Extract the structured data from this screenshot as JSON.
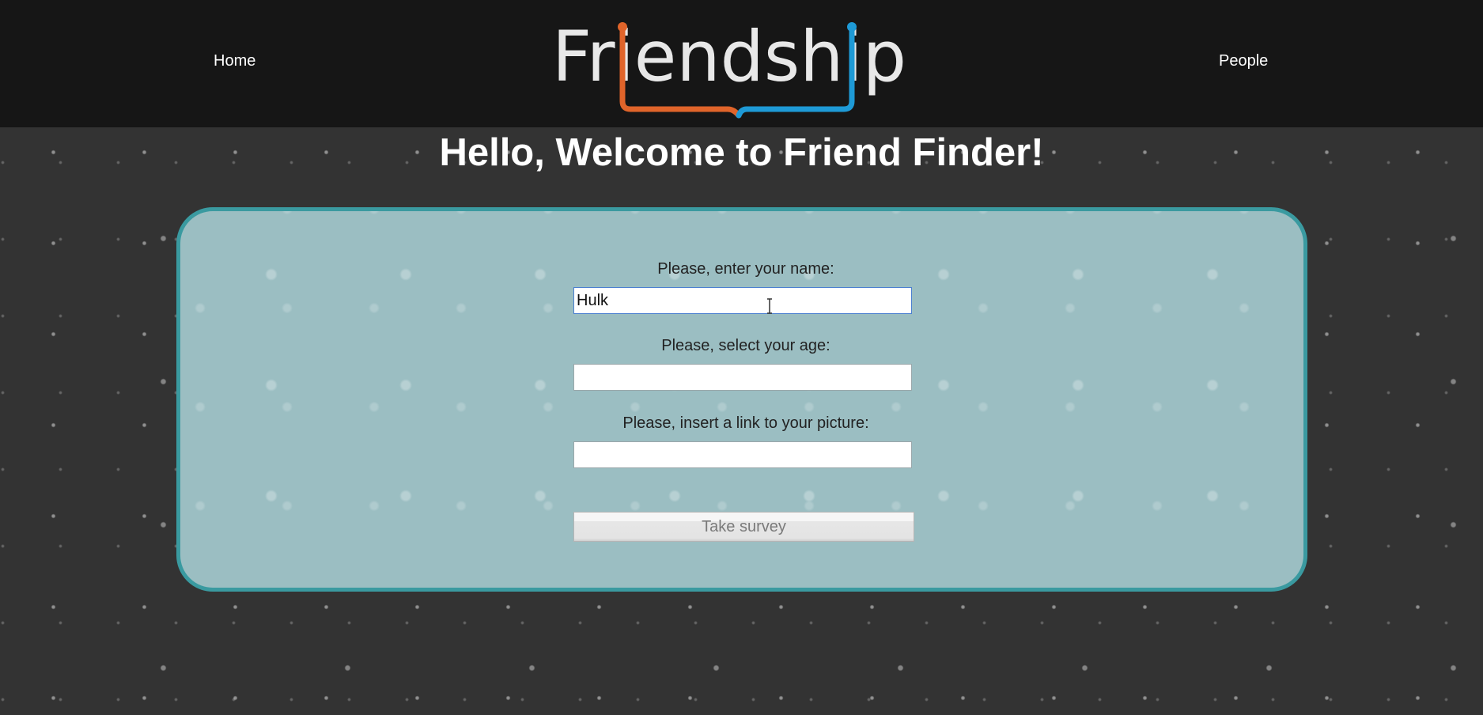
{
  "nav": {
    "home_label": "Home",
    "people_label": "People"
  },
  "logo": {
    "text": "Friendship",
    "accent_left": "#e0642a",
    "accent_right": "#1e9ad6"
  },
  "page": {
    "title": "Hello, Welcome to Friend Finder!"
  },
  "form": {
    "name_label": "Please, enter your name:",
    "name_value": "Hulk",
    "age_label": "Please, select your age:",
    "age_value": "",
    "picture_label": "Please, insert a link to your picture:",
    "picture_value": "",
    "submit_label": "Take survey"
  },
  "colors": {
    "navbar_bg": "#161616",
    "page_bg": "#333333",
    "panel_bg": "#9bbec2",
    "panel_border": "#3a9aa0"
  },
  "icons": {
    "cursor": "text-cursor-icon"
  }
}
